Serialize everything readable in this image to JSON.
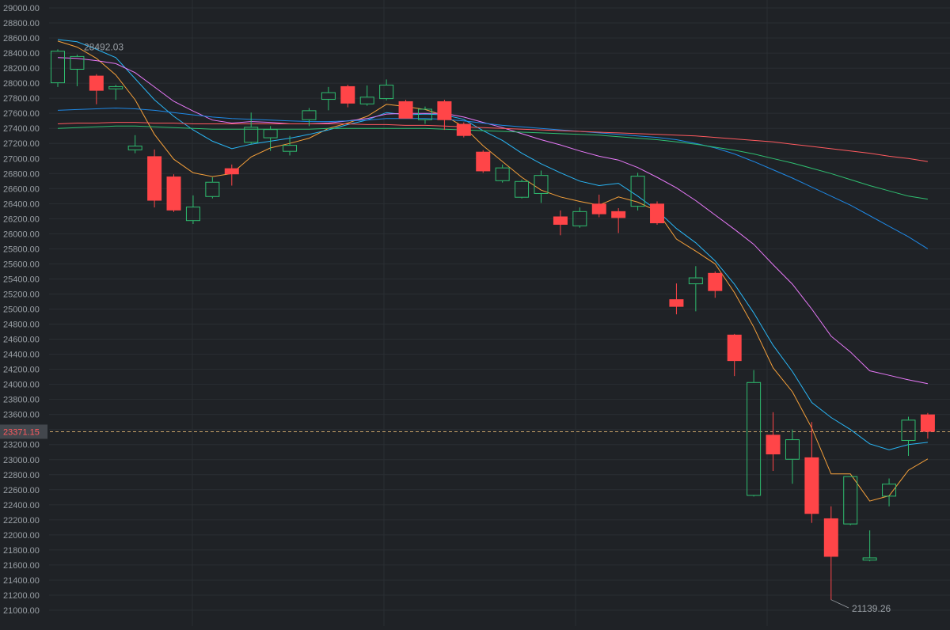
{
  "chart_data": {
    "type": "candlestick",
    "ylim": [
      21000,
      29000
    ],
    "y_tick_step": 200,
    "grid": true,
    "current_price": 23371.15,
    "current_price_label": "23371.15",
    "high_label": "28492.03",
    "low_label": "21139.26",
    "colors": {
      "background": "#1f2226",
      "grid": "#2a2e33",
      "axis_text": "#9aa0a6",
      "up": "#2ebd6f",
      "down": "#ff4548",
      "price_line": "#c9a36a",
      "price_label_bg": "#43474d",
      "price_label_text": "#ff5a5f"
    },
    "candles": [
      {
        "o": 28000,
        "h": 28450,
        "l": 27950,
        "c": 28430
      },
      {
        "o": 28180,
        "h": 28380,
        "l": 27960,
        "c": 28360
      },
      {
        "o": 28100,
        "h": 28120,
        "l": 27720,
        "c": 27900
      },
      {
        "o": 27920,
        "h": 27980,
        "l": 27780,
        "c": 27960
      },
      {
        "o": 27110,
        "h": 27310,
        "l": 27070,
        "c": 27170
      },
      {
        "o": 27030,
        "h": 27120,
        "l": 26350,
        "c": 26440
      },
      {
        "o": 26760,
        "h": 26790,
        "l": 26290,
        "c": 26310
      },
      {
        "o": 26170,
        "h": 26510,
        "l": 26130,
        "c": 26360
      },
      {
        "o": 26490,
        "h": 26750,
        "l": 26470,
        "c": 26690
      },
      {
        "o": 26870,
        "h": 26920,
        "l": 26640,
        "c": 26790
      },
      {
        "o": 27210,
        "h": 27610,
        "l": 27190,
        "c": 27420
      },
      {
        "o": 27270,
        "h": 27430,
        "l": 27100,
        "c": 27390
      },
      {
        "o": 27090,
        "h": 27300,
        "l": 27040,
        "c": 27180
      },
      {
        "o": 27510,
        "h": 27670,
        "l": 27430,
        "c": 27640
      },
      {
        "o": 27780,
        "h": 27950,
        "l": 27640,
        "c": 27880
      },
      {
        "o": 27960,
        "h": 27980,
        "l": 27680,
        "c": 27730
      },
      {
        "o": 27720,
        "h": 27970,
        "l": 27700,
        "c": 27820
      },
      {
        "o": 27790,
        "h": 28050,
        "l": 27770,
        "c": 27980
      },
      {
        "o": 27760,
        "h": 27780,
        "l": 27540,
        "c": 27530
      },
      {
        "o": 27510,
        "h": 27690,
        "l": 27460,
        "c": 27660
      },
      {
        "o": 27760,
        "h": 27780,
        "l": 27380,
        "c": 27510
      },
      {
        "o": 27460,
        "h": 27480,
        "l": 27280,
        "c": 27300
      },
      {
        "o": 27090,
        "h": 27110,
        "l": 26810,
        "c": 26830
      },
      {
        "o": 26700,
        "h": 26920,
        "l": 26680,
        "c": 26880
      },
      {
        "o": 26480,
        "h": 26720,
        "l": 26470,
        "c": 26700
      },
      {
        "o": 26530,
        "h": 26840,
        "l": 26410,
        "c": 26780
      },
      {
        "o": 26230,
        "h": 26310,
        "l": 25980,
        "c": 26120
      },
      {
        "o": 26100,
        "h": 26350,
        "l": 26080,
        "c": 26300
      },
      {
        "o": 26400,
        "h": 26520,
        "l": 26220,
        "c": 26260
      },
      {
        "o": 26300,
        "h": 26340,
        "l": 26010,
        "c": 26210
      },
      {
        "o": 26360,
        "h": 26810,
        "l": 26310,
        "c": 26770
      },
      {
        "o": 26400,
        "h": 26430,
        "l": 26120,
        "c": 26140
      },
      {
        "o": 25130,
        "h": 25340,
        "l": 24930,
        "c": 25030
      },
      {
        "o": 25330,
        "h": 25570,
        "l": 24970,
        "c": 25420
      },
      {
        "o": 25480,
        "h": 25500,
        "l": 25150,
        "c": 25240
      },
      {
        "o": 24660,
        "h": 24670,
        "l": 24110,
        "c": 24310
      },
      {
        "o": 22520,
        "h": 24190,
        "l": 22510,
        "c": 24030
      },
      {
        "o": 23330,
        "h": 23630,
        "l": 22850,
        "c": 23070
      },
      {
        "o": 23000,
        "h": 23400,
        "l": 22680,
        "c": 23270
      },
      {
        "o": 23030,
        "h": 23500,
        "l": 22160,
        "c": 22280
      },
      {
        "o": 22220,
        "h": 22380,
        "l": 21140,
        "c": 21710
      },
      {
        "o": 22140,
        "h": 22780,
        "l": 22130,
        "c": 22780
      },
      {
        "o": 21660,
        "h": 22060,
        "l": 21650,
        "c": 21700
      },
      {
        "o": 22510,
        "h": 22750,
        "l": 22380,
        "c": 22680
      },
      {
        "o": 23250,
        "h": 23570,
        "l": 23050,
        "c": 23530
      },
      {
        "o": 23600,
        "h": 23620,
        "l": 23280,
        "c": 23370
      }
    ],
    "moving_averages": [
      {
        "color": "#f5a03a",
        "values": [
          28560,
          28480,
          28330,
          28110,
          27780,
          27320,
          26990,
          26810,
          26760,
          26800,
          27020,
          27140,
          27200,
          27270,
          27400,
          27470,
          27560,
          27720,
          27690,
          27650,
          27570,
          27420,
          27170,
          26960,
          26750,
          26580,
          26490,
          26430,
          26380,
          26490,
          26420,
          26300,
          25930,
          25770,
          25600,
          25220,
          24760,
          24220,
          23900,
          23420,
          22810,
          22810,
          22450,
          22520,
          22860,
          23010
        ]
      },
      {
        "color": "#29b6f6",
        "values": [
          28580,
          28550,
          28450,
          28340,
          28060,
          27780,
          27560,
          27380,
          27230,
          27130,
          27190,
          27230,
          27270,
          27320,
          27380,
          27450,
          27510,
          27610,
          27580,
          27590,
          27580,
          27520,
          27370,
          27240,
          27070,
          26930,
          26810,
          26700,
          26640,
          26670,
          26500,
          26310,
          26070,
          25880,
          25640,
          25330,
          24950,
          24520,
          24170,
          23760,
          23560,
          23400,
          23210,
          23130,
          23200,
          23230
        ]
      },
      {
        "color": "#e879f9",
        "values": [
          28340,
          28330,
          28300,
          28260,
          28140,
          27950,
          27760,
          27630,
          27510,
          27470,
          27490,
          27480,
          27460,
          27460,
          27470,
          27500,
          27530,
          27590,
          27600,
          27600,
          27600,
          27550,
          27480,
          27410,
          27330,
          27250,
          27180,
          27100,
          27030,
          26980,
          26880,
          26750,
          26610,
          26440,
          26250,
          26060,
          25860,
          25590,
          25330,
          25000,
          24640,
          24430,
          24180,
          24120,
          24060,
          24010
        ]
      },
      {
        "color": "#1e88e5",
        "values": [
          27640,
          27650,
          27660,
          27670,
          27660,
          27640,
          27610,
          27580,
          27550,
          27530,
          27520,
          27510,
          27500,
          27490,
          27490,
          27500,
          27510,
          27530,
          27530,
          27530,
          27520,
          27500,
          27470,
          27440,
          27420,
          27400,
          27380,
          27360,
          27340,
          27320,
          27300,
          27280,
          27250,
          27200,
          27140,
          27060,
          26960,
          26850,
          26740,
          26620,
          26500,
          26380,
          26240,
          26100,
          25960,
          25800
        ]
      },
      {
        "color": "#ff5a5f",
        "values": [
          27460,
          27470,
          27470,
          27480,
          27480,
          27470,
          27470,
          27460,
          27460,
          27460,
          27460,
          27460,
          27460,
          27460,
          27460,
          27460,
          27450,
          27450,
          27440,
          27440,
          27430,
          27420,
          27410,
          27400,
          27390,
          27380,
          27370,
          27360,
          27350,
          27340,
          27330,
          27320,
          27310,
          27300,
          27280,
          27260,
          27240,
          27220,
          27190,
          27160,
          27130,
          27100,
          27070,
          27030,
          27000,
          26960
        ]
      },
      {
        "color": "#2fbf71",
        "values": [
          27400,
          27410,
          27420,
          27430,
          27430,
          27420,
          27410,
          27400,
          27390,
          27390,
          27390,
          27390,
          27390,
          27390,
          27400,
          27400,
          27400,
          27400,
          27400,
          27400,
          27390,
          27380,
          27370,
          27360,
          27350,
          27340,
          27330,
          27320,
          27310,
          27290,
          27270,
          27250,
          27220,
          27190,
          27150,
          27110,
          27060,
          27000,
          26940,
          26870,
          26800,
          26720,
          26640,
          26570,
          26500,
          26460
        ]
      }
    ]
  }
}
